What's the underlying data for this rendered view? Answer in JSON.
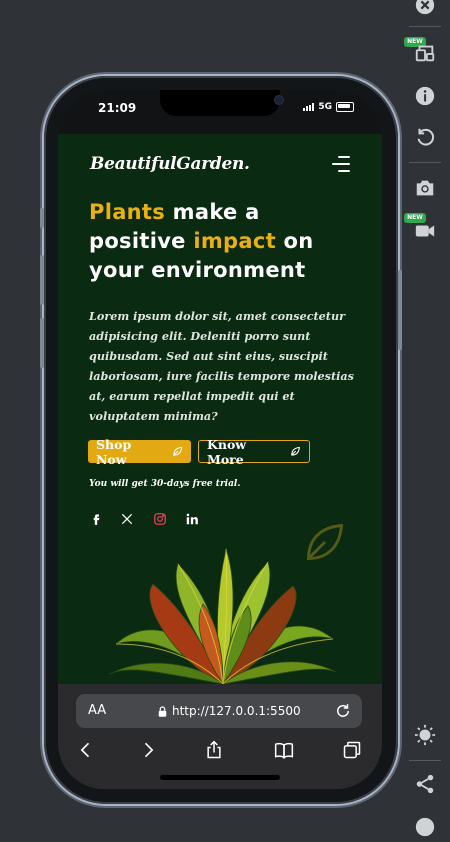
{
  "status_bar": {
    "time": "21:09",
    "network": "5G"
  },
  "site": {
    "logo": "BeautifulGarden."
  },
  "hero": {
    "title_parts": [
      {
        "text": "Plants",
        "accent": true
      },
      {
        "text": " make a positive ",
        "accent": false
      },
      {
        "text": "impact",
        "accent": true
      },
      {
        "text": " on your environment",
        "accent": false
      }
    ],
    "description": "Lorem ipsum dolor sit, amet consectetur adipisicing elit. Deleniti porro sunt quibusdam. Sed aut sint eius, suscipit laboriosam, iure facilis tempore molestias at, earum repellat impedit qui et voluptatem minima?",
    "primary_button": "Shop Now",
    "secondary_button": "Know More",
    "trial_note": "You will get 30-days free trial."
  },
  "social_icons": [
    "facebook-icon",
    "x-icon",
    "instagram-icon",
    "linkedin-icon"
  ],
  "browser": {
    "aa_label": "AA",
    "url": "http://127.0.0.1:5500"
  },
  "toolbar_badges": {
    "new": "NEW"
  },
  "colors": {
    "accent": "#e3a912",
    "background": "#0b2a12",
    "instagram": "#e4405f"
  }
}
